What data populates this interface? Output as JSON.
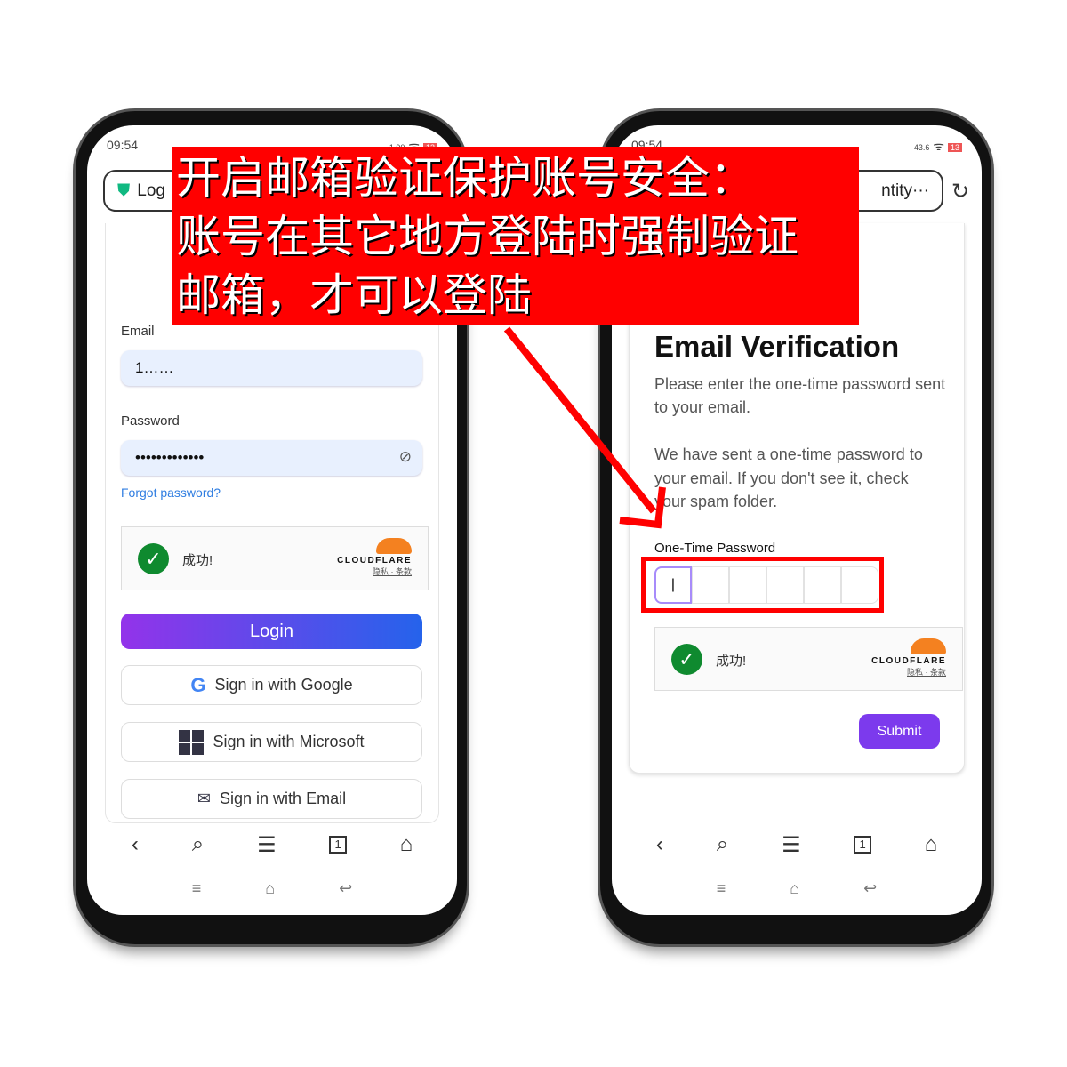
{
  "banner": {
    "line1": "开启邮箱验证保护账号安全：",
    "line2": "账号在其它地方登陆时强制验证",
    "line3": "邮箱，才可以登陆"
  },
  "left": {
    "status_time": "09:54",
    "status_speed": "1.90",
    "battery": "13",
    "url": "Log",
    "email_label": "Email",
    "email_value": "1……",
    "password_label": "Password",
    "password_value": "•••••••••••••",
    "forgot": "Forgot password?",
    "captcha_text": "成功!",
    "cf_name": "CLOUDFLARE",
    "cf_links": "隐私 · 条款",
    "login": "Login",
    "google": "Sign in with Google",
    "microsoft": "Sign in with Microsoft",
    "email_btn": "Sign in with Email",
    "tab_count": "1"
  },
  "right": {
    "status_time": "09:54",
    "status_speed": "43.6",
    "battery": "13",
    "url": "ntity···",
    "title": "Email Verification",
    "p1": "Please enter the one-time password sent to your email.",
    "p2": "We have sent a one-time password to your email. If you don't see it, check your spam folder.",
    "otp_label": "One-Time Password",
    "captcha_text": "成功!",
    "cf_name": "CLOUDFLARE",
    "cf_links": "隐私 · 条款",
    "submit": "Submit",
    "tab_count": "1"
  },
  "colors": {
    "banner": "#ff0000",
    "login_start": "#9333ea",
    "login_end": "#2563eb",
    "submit": "#7c3aed",
    "check": "#0f8a2f",
    "cloudflare": "#f48120"
  }
}
